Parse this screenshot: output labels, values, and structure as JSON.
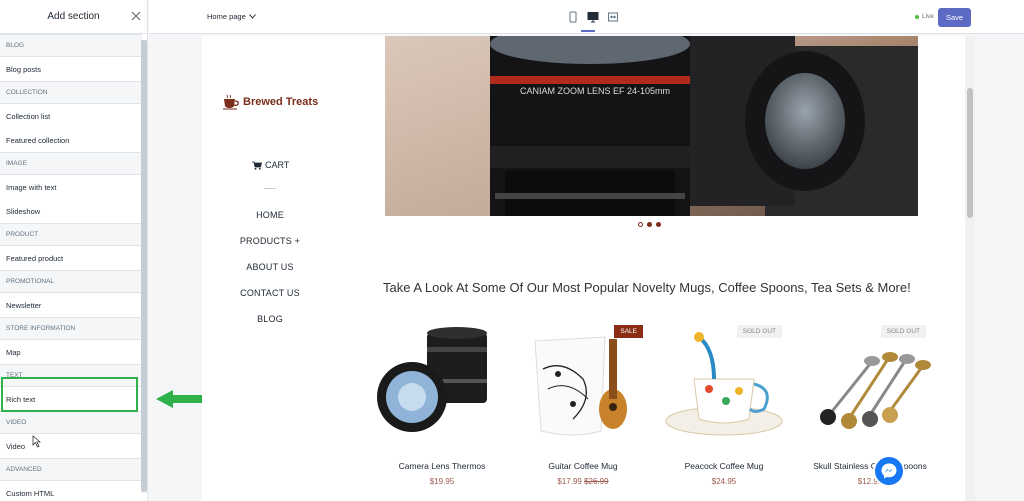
{
  "sidebar": {
    "title": "Add section",
    "groups": [
      {
        "header": "BLOG",
        "items": [
          "Blog posts"
        ]
      },
      {
        "header": "COLLECTION",
        "items": [
          "Collection list",
          "Featured collection"
        ]
      },
      {
        "header": "IMAGE",
        "items": [
          "Image with text",
          "Slideshow"
        ]
      },
      {
        "header": "PRODUCT",
        "items": [
          "Featured product"
        ]
      },
      {
        "header": "PROMOTIONAL",
        "items": [
          "Newsletter"
        ]
      },
      {
        "header": "STORE INFORMATION",
        "items": [
          "Map"
        ]
      },
      {
        "header": "TEXT",
        "items": [
          "Rich text"
        ]
      },
      {
        "header": "VIDEO",
        "items": [
          "Video"
        ]
      },
      {
        "header": "ADVANCED",
        "items": [
          "Custom HTML"
        ]
      }
    ]
  },
  "topbar": {
    "page_select": "Home page",
    "status": "Live",
    "save_label": "Save"
  },
  "store": {
    "logo": "Brewed Treats",
    "cart": "CART",
    "nav": [
      "HOME",
      "PRODUCTS +",
      "ABOUT US",
      "CONTACT US",
      "BLOG"
    ],
    "hero_lens_text": "CANIAM ZOOM LENS EF 24-105mm",
    "tagline": "Take A Look At Some Of Our Most Popular Novelty Mugs, Coffee Spoons, Tea Sets & More!",
    "products": [
      {
        "name": "Camera Lens Thermos",
        "price": "$19.95",
        "compare": "",
        "badge": ""
      },
      {
        "name": "Guitar Coffee Mug",
        "price": "$17.99",
        "compare": "$26.99",
        "badge": "SALE"
      },
      {
        "name": "Peacock Coffee Mug",
        "price": "$24.95",
        "compare": "",
        "badge": "SOLD OUT"
      },
      {
        "name": "Skull Stainless Coffee Spoons",
        "price": "$12.95",
        "compare": "",
        "badge": "SOLD OUT"
      }
    ]
  },
  "colors": {
    "accent": "#5c6ac4",
    "highlight": "#2fb14a",
    "brand": "#7a2d1a"
  }
}
